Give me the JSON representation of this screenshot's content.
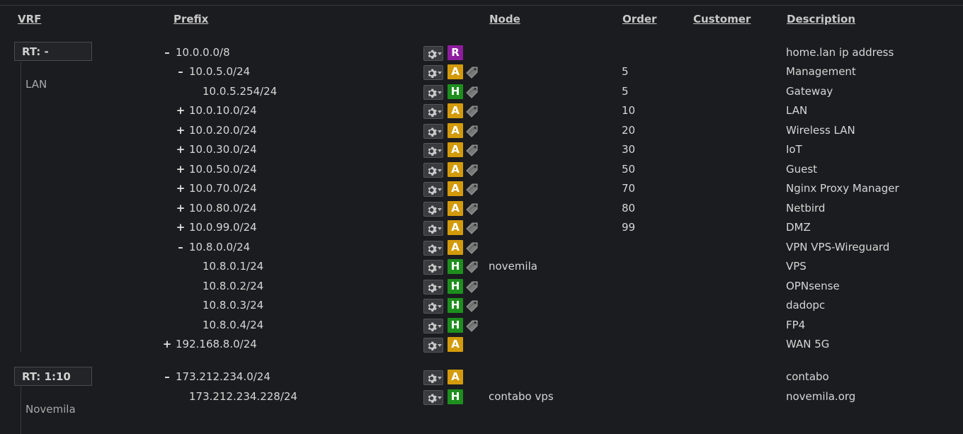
{
  "columns": {
    "vrf": "VRF",
    "prefix": "Prefix",
    "node": "Node",
    "order": "Order",
    "customer": "Customer",
    "description": "Description"
  },
  "vrfs": [
    {
      "rt": "RT: -",
      "name": "LAN"
    },
    {
      "rt": "RT: 1:10",
      "name": "Novemila"
    }
  ],
  "colors": {
    "R": "#8e1d9e",
    "A": "#d39b0b",
    "H": "#1e8f1e"
  },
  "rows": [
    {
      "toggle": "–",
      "prefix": "10.0.0.0/8",
      "type": "R",
      "tag": false,
      "node": "",
      "order": "",
      "description": "home.lan ip address"
    },
    {
      "toggle": "–",
      "prefix": "10.0.5.0/24",
      "type": "A",
      "tag": true,
      "node": "",
      "order": "5",
      "description": "Management"
    },
    {
      "toggle": "",
      "prefix": "10.0.5.254/24",
      "type": "H",
      "tag": true,
      "node": "",
      "order": "5",
      "description": "Gateway"
    },
    {
      "toggle": "+",
      "prefix": "10.0.10.0/24",
      "type": "A",
      "tag": true,
      "node": "",
      "order": "10",
      "description": "LAN"
    },
    {
      "toggle": "+",
      "prefix": "10.0.20.0/24",
      "type": "A",
      "tag": true,
      "node": "",
      "order": "20",
      "description": "Wireless LAN"
    },
    {
      "toggle": "+",
      "prefix": "10.0.30.0/24",
      "type": "A",
      "tag": true,
      "node": "",
      "order": "30",
      "description": "IoT"
    },
    {
      "toggle": "+",
      "prefix": "10.0.50.0/24",
      "type": "A",
      "tag": true,
      "node": "",
      "order": "50",
      "description": "Guest"
    },
    {
      "toggle": "+",
      "prefix": "10.0.70.0/24",
      "type": "A",
      "tag": true,
      "node": "",
      "order": "70",
      "description": "Nginx Proxy Manager"
    },
    {
      "toggle": "+",
      "prefix": "10.0.80.0/24",
      "type": "A",
      "tag": true,
      "node": "",
      "order": "80",
      "description": "Netbird"
    },
    {
      "toggle": "+",
      "prefix": "10.0.99.0/24",
      "type": "A",
      "tag": true,
      "node": "",
      "order": "99",
      "description": "DMZ"
    },
    {
      "toggle": "–",
      "prefix": "10.8.0.0/24",
      "type": "A",
      "tag": true,
      "node": "",
      "order": "",
      "description": "VPN VPS-Wireguard"
    },
    {
      "toggle": "",
      "prefix": "10.8.0.1/24",
      "type": "H",
      "tag": true,
      "node": "novemila",
      "order": "",
      "description": "VPS"
    },
    {
      "toggle": "",
      "prefix": "10.8.0.2/24",
      "type": "H",
      "tag": true,
      "node": "",
      "order": "",
      "description": "OPNsense"
    },
    {
      "toggle": "",
      "prefix": "10.8.0.3/24",
      "type": "H",
      "tag": true,
      "node": "",
      "order": "",
      "description": "dadopc"
    },
    {
      "toggle": "",
      "prefix": "10.8.0.4/24",
      "type": "H",
      "tag": true,
      "node": "",
      "order": "",
      "description": "FP4"
    },
    {
      "toggle": "+",
      "prefix": "192.168.8.0/24",
      "type": "A",
      "tag": false,
      "node": "",
      "order": "",
      "description": "WAN 5G"
    },
    {
      "toggle": "–",
      "prefix": "173.212.234.0/24",
      "type": "A",
      "tag": false,
      "node": "",
      "order": "",
      "description": "contabo"
    },
    {
      "toggle": "",
      "prefix": "173.212.234.228/24",
      "type": "H",
      "tag": false,
      "node": "contabo vps",
      "order": "",
      "description": "novemila.org"
    }
  ]
}
